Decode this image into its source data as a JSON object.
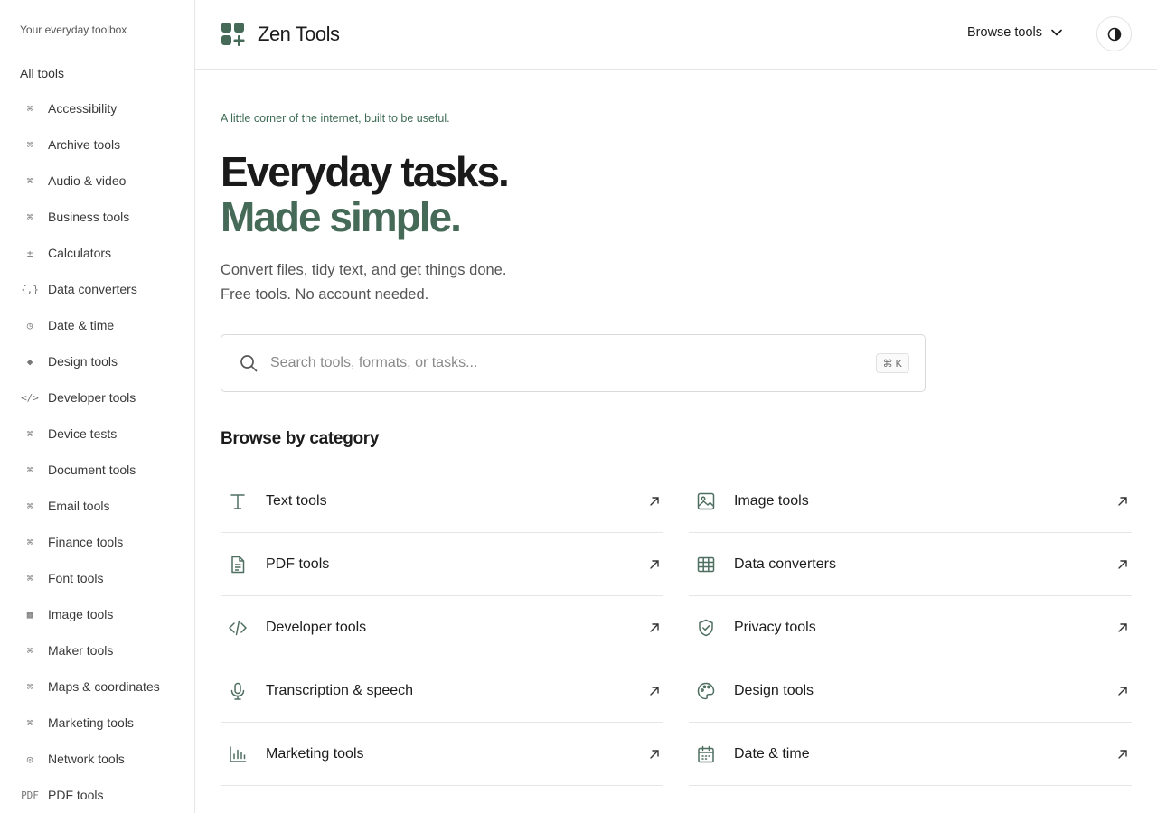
{
  "sidebar": {
    "tagline": "Your everyday toolbox",
    "all_tools": "All tools",
    "items": [
      {
        "label": "Accessibility",
        "icon": "⌘"
      },
      {
        "label": "Archive tools",
        "icon": "⌘"
      },
      {
        "label": "Audio & video",
        "icon": "⌘"
      },
      {
        "label": "Business tools",
        "icon": "⌘"
      },
      {
        "label": "Calculators",
        "icon": "±"
      },
      {
        "label": "Data converters",
        "icon": "{,}"
      },
      {
        "label": "Date & time",
        "icon": "◷"
      },
      {
        "label": "Design tools",
        "icon": "◆"
      },
      {
        "label": "Developer tools",
        "icon": "</>"
      },
      {
        "label": "Device tests",
        "icon": "⌘"
      },
      {
        "label": "Document tools",
        "icon": "⌘"
      },
      {
        "label": "Email tools",
        "icon": "⌘"
      },
      {
        "label": "Finance tools",
        "icon": "⌘"
      },
      {
        "label": "Font tools",
        "icon": "⌘"
      },
      {
        "label": "Image tools",
        "icon": "▩"
      },
      {
        "label": "Maker tools",
        "icon": "⌘"
      },
      {
        "label": "Maps & coordinates",
        "icon": "⌘"
      },
      {
        "label": "Marketing tools",
        "icon": "⌘"
      },
      {
        "label": "Network tools",
        "icon": "◎"
      },
      {
        "label": "PDF tools",
        "icon": "PDF"
      }
    ]
  },
  "header": {
    "brand": "Zen Tools",
    "browse_label": "Browse tools"
  },
  "hero": {
    "kicker": "A little corner of the internet, built to be useful.",
    "title_line1": "Everyday tasks.",
    "title_line2": "Made simple.",
    "sub_line1": "Convert files, tidy text, and get things done.",
    "sub_line2": "Free tools. No account needed."
  },
  "search": {
    "placeholder": "Search tools, formats, or tasks...",
    "shortcut": "⌘ K"
  },
  "categories": {
    "title": "Browse by category",
    "items": [
      {
        "label": "Text tools",
        "icon": "text-icon"
      },
      {
        "label": "Image tools",
        "icon": "image-icon"
      },
      {
        "label": "PDF tools",
        "icon": "file-icon"
      },
      {
        "label": "Data converters",
        "icon": "table-icon"
      },
      {
        "label": "Developer tools",
        "icon": "code-icon"
      },
      {
        "label": "Privacy tools",
        "icon": "shield-icon"
      },
      {
        "label": "Transcription & speech",
        "icon": "microphone-icon"
      },
      {
        "label": "Design tools",
        "icon": "palette-icon"
      },
      {
        "label": "Marketing tools",
        "icon": "bar-chart-icon"
      },
      {
        "label": "Date & time",
        "icon": "calendar-icon"
      }
    ]
  },
  "colors": {
    "accent": "#466a58",
    "kicker": "#3d6b55",
    "icon": "#4f6f60"
  }
}
